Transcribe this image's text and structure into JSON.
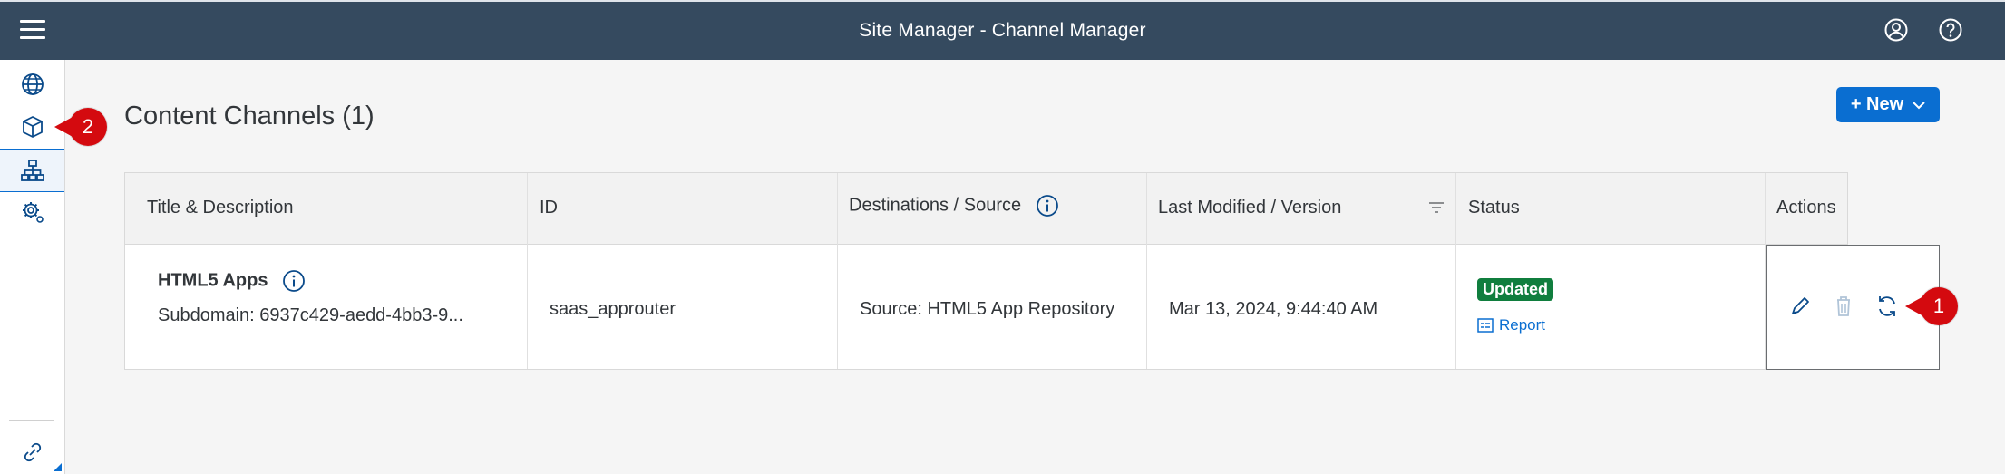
{
  "shell": {
    "title": "Site Manager - Channel Manager",
    "menu_icon": "hamburger-icon",
    "user_icon": "user-icon",
    "help_icon": "help-icon"
  },
  "sidenav": {
    "items": [
      {
        "name": "sites",
        "icon": "globe-icon"
      },
      {
        "name": "content",
        "icon": "cube-icon"
      },
      {
        "name": "channel-manager",
        "icon": "hierarchy-icon",
        "selected": true
      },
      {
        "name": "settings",
        "icon": "gear-icon"
      }
    ],
    "bottom_icon": "link-icon"
  },
  "callouts": {
    "nav": "2",
    "actions": "1"
  },
  "page": {
    "title": "Content Channels (1)",
    "new_button": "+ New"
  },
  "table": {
    "headers": {
      "title": "Title & Description",
      "id": "ID",
      "destinations": "Destinations / Source",
      "modified": "Last Modified / Version",
      "status": "Status",
      "actions": "Actions"
    },
    "rows": [
      {
        "title": "HTML5 Apps",
        "description": "Subdomain: 6937c429-aedd-4bb3-9...",
        "id": "saas_approuter",
        "source": "Source: HTML5 App Repository",
        "modified": "Mar 13, 2024, 9:44:40 AM",
        "status": "Updated",
        "report": "Report"
      }
    ]
  },
  "colors": {
    "shell": "#354a5f",
    "accent": "#0a6ed1",
    "success": "#107e3e",
    "callout": "#d40a0f"
  }
}
